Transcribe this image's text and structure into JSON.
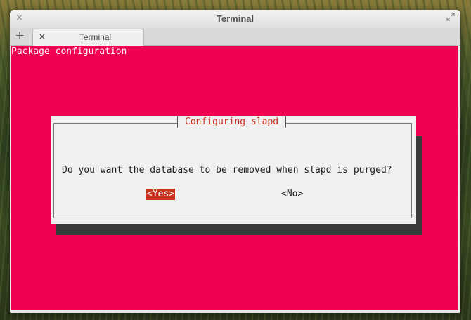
{
  "window": {
    "title": "Terminal",
    "close_glyph": "×"
  },
  "tabs": {
    "new_tab_glyph": "+",
    "items": [
      {
        "label": "Terminal",
        "close_glyph": "×"
      }
    ]
  },
  "terminal": {
    "background": "#ef0250",
    "header": "Package configuration",
    "dialog": {
      "title": "Configuring slapd",
      "question": "Do you want the database to be removed when slapd is purged?",
      "yes_label": "<Yes>",
      "no_label": "<No>",
      "selected": "yes",
      "accent_color": "#c8311b"
    }
  },
  "icons": {
    "window_close": "close-icon",
    "window_maximize": "maximize-icon",
    "new_tab": "plus-icon",
    "tab_close": "close-icon"
  }
}
